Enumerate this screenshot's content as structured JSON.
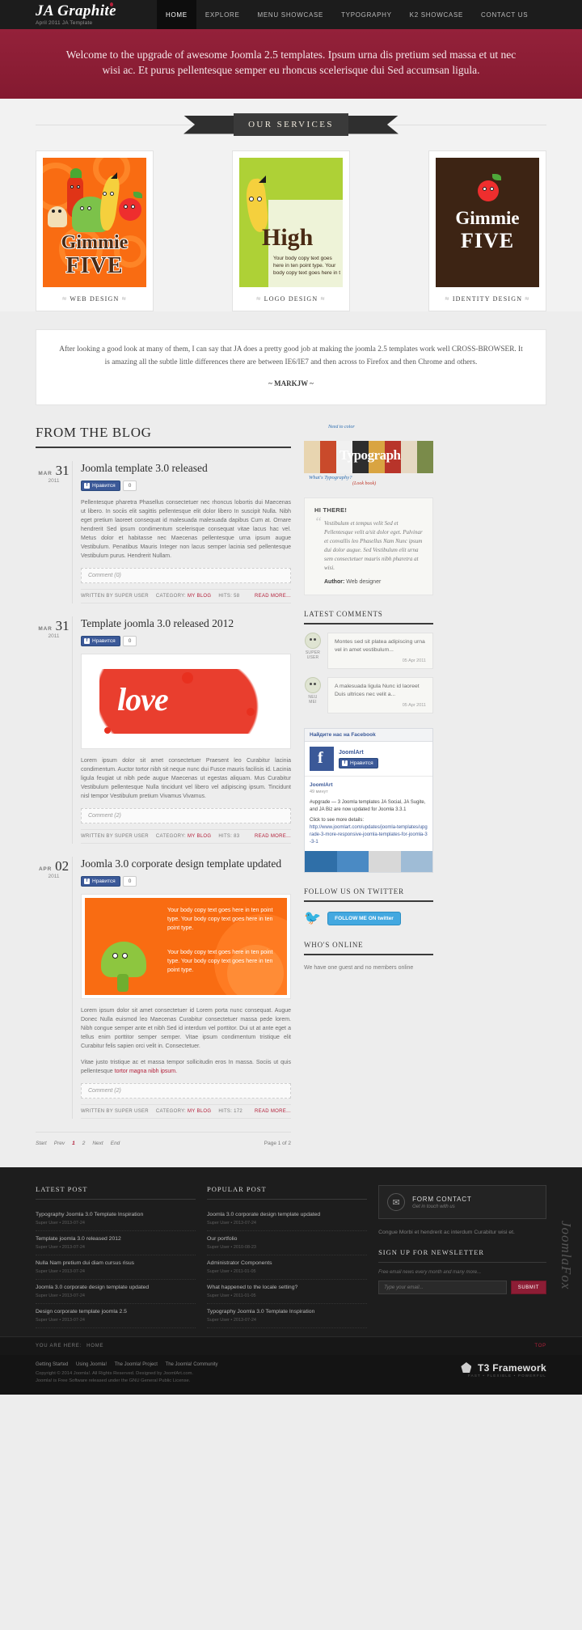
{
  "header": {
    "logo_title": "JA Graphite",
    "logo_sub": "April 2011 JA Template",
    "nav": [
      {
        "label": "HOME",
        "active": true
      },
      {
        "label": "EXPLORE",
        "active": false
      },
      {
        "label": "MENU SHOWCASE",
        "active": false
      },
      {
        "label": "TYPOGRAPHY",
        "active": false
      },
      {
        "label": "K2 SHOWCASE",
        "active": false
      },
      {
        "label": "CONTACT US",
        "active": false
      }
    ]
  },
  "hero": {
    "text": "Welcome to the upgrade of awesome Joomla 2.5 templates. Ipsum urna dis pretium sed massa et ut nec wisi ac. Et purus pellentesque semper eu rhoncus scelerisque dui Sed accumsan ligula."
  },
  "services": {
    "ribbon_label": "OUR SERVICES",
    "cards": [
      {
        "caption": "WEB DESIGN",
        "poster_line1": "Gimmie",
        "poster_line2": "FIVE",
        "style": "orange"
      },
      {
        "caption": "LOGO DESIGN",
        "poster_line1": "High",
        "poster_line2": "",
        "style": "green",
        "body": "Your body copy text goes here in ten point type. Your body copy text goes here in t"
      },
      {
        "caption": "IDENTITY DESIGN",
        "poster_line1": "Gimmie",
        "poster_line2": "FIVE",
        "style": "brown"
      }
    ]
  },
  "testimonial": {
    "text": "After looking a good look at many of them, I can say that JA does a pretty good job at making the joomla 2.5 templates work well CROSS-BROWSER. It is amazing all the subtle little differences there are between IE6/IE7 and then across to Firefox and then Chrome and others.",
    "author": "~ MARKJW ~"
  },
  "blog": {
    "section_title": "FROM THE BLOG",
    "posts": [
      {
        "month": "MAR",
        "day": "31",
        "year": "2011",
        "title": "Joomla template 3.0 released",
        "like_label": "Нравится",
        "like_count": "0",
        "text": "Pellentesque pharetra Phasellus consectetuer nec rhoncus lobortis dui Maecenas ut libero. In sociis elit sagittis pellentesque elit dolor libero In suscipit Nulla. Nibh eget pretium laoreet consequat id malesuada malesuada dapibus Cum at. Ornare hendrerit Sed ipsum condimentum scelerisque consequat vitae lacus hac vel. Metus dolor et habitasse nec Maecenas pellentesque urna ipsum augue Vestibulum. Penatibus Mauris Integer non lacus semper lacinia sed pellentesque Vestibulum purus. Hendrerit Nullam.",
        "comment_placeholder": "Comment (0)",
        "meta_author": "WRITTEN BY SUPER USER",
        "meta_category_label": "CATEGORY:",
        "meta_category": "MY BLOG",
        "meta_hits": "HITS: 58",
        "readmore": "READ MORE...",
        "figure": "none"
      },
      {
        "month": "MAR",
        "day": "31",
        "year": "2011",
        "title": "Template joomla 3.0 released 2012",
        "like_label": "Нравится",
        "like_count": "0",
        "text": "Lorem ipsum dolor sit amet consectetuer Praesent leo Curabitur lacinia condimentum. Auctor tortor nibh sit neque nunc dui Fusce mauris facilisis id. Lacinia ligula feugiat ut nibh pede augue Maecenas ut egestas aliquam. Mus Curabitur Vestibulum pellentesque Nulla tincidunt vel libero vel adipiscing ipsum. Tincidunt nisl tempor Vestibulum pretium Vivamus Vivamus.",
        "comment_placeholder": "Comment (2)",
        "meta_author": "WRITTEN BY SUPER USER",
        "meta_category_label": "CATEGORY:",
        "meta_category": "MY BLOG",
        "meta_hits": "HITS: 83",
        "readmore": "READ MORE...",
        "figure": "love"
      },
      {
        "month": "APR",
        "day": "02",
        "year": "2011",
        "title": "Joomla 3.0 corporate design template updated",
        "like_label": "Нравится",
        "like_count": "0",
        "text": "Lorem ipsum dolor sit amet consectetuer id Lorem porta nunc consequat. Augue Donec Nulla euismod leo Maecenas Curabitur consectetuer massa pede lorem. Nibh congue semper ante et nibh Sed id interdum vel porttitor. Dui ut at ante eget a tellus enim porttitor semper semper. Vitae ipsum condimentum tristique elit Curabitur felis sapien orci velit in. Consectetuer.",
        "text2": "Vitae justo tristique ac et massa tempor sollicitudin eros In massa. Sociis ut quis pellentesque",
        "text2_link": "tortor magna nibh ipsum.",
        "comment_placeholder": "Comment (2)",
        "meta_author": "WRITTEN BY SUPER USER",
        "meta_category_label": "CATEGORY:",
        "meta_category": "MY BLOG",
        "meta_hits": "HITS: 172",
        "readmore": "READ MORE...",
        "figure": "broccoli",
        "figure_text1": "Your body copy text goes here in ten point type. Your body copy text goes here in ten point type.",
        "figure_text2": "Your body copy text goes here in ten point type. Your body copy text goes here in ten point type."
      }
    ],
    "pagination": {
      "start": "Start",
      "prev": "Prev",
      "pages": [
        "1",
        "2"
      ],
      "current": "1",
      "next": "Next",
      "end": "End",
      "status": "Page 1 of 2"
    }
  },
  "sidebar": {
    "typo_banner": {
      "note_top": "Need to color",
      "note_bottom": "What's Typography?",
      "note_bottom2": "(Look book)",
      "word": "Typograph"
    },
    "quote": {
      "hi": "HI THERE!",
      "text": "Vestibulum et tempus velit Sed et Pellentesque velit a/sit dolor eget. Pulvinar et convallis leo Phasellus Nam Nunc ipsum dui dolor augue. Sed Vestibulum elit urna sem consectetuer mauris nibh pharetra at wisi.",
      "author_label": "Author:",
      "author": "Web designer"
    },
    "comments": {
      "title": "LATEST COMMENTS",
      "items": [
        {
          "name": "SUPER USER",
          "text": "Montes sed sit platea adipiscing urna vel in amet vestibulum...",
          "date": "05 Apr 2011"
        },
        {
          "name": "NEU MEI",
          "text": "A malesuada ligula Nunc id laoreet Duis ultrices nec velit a...",
          "date": "05 Apr 2011"
        }
      ]
    },
    "facebook": {
      "header": "Найдите нас на Facebook",
      "page_name": "JoomlArt",
      "like_label": "Нравится",
      "post_author": "JoomlArt",
      "post_time": "49 минут",
      "post_text": "#upgrade — 3 Joomla templates JA Social, JA Sugite, and JA Biz are now updated for Joomla 3.3.1",
      "post_cta": "Click to see more details:",
      "post_link": "http://www.joomlart.com/updates/joomla-templates/upgrade-3-more-responsive-joomla-templates-for-joomla-3-3-1"
    },
    "twitter": {
      "title": "FOLLOW US ON TWITTER",
      "button": "FOLLOW ME ON twitter"
    },
    "who_online": {
      "title": "WHO'S ONLINE",
      "text": "We have one guest and no members online"
    }
  },
  "footer": {
    "latest_post": {
      "title": "LATEST POST",
      "items": [
        {
          "t": "Typography Joomla 3.0 Template Inspiration",
          "m": "Super User • 2013-07-24"
        },
        {
          "t": "Template joomla 3.0 released 2012",
          "m": "Super User • 2013-07-24"
        },
        {
          "t": "Nulla Nam pretium dui diam cursus risus",
          "m": "Super User • 2013-07-24"
        },
        {
          "t": "Joomla 3.0 corporate design template updated",
          "m": "Super User • 2013-07-24"
        },
        {
          "t": "Design corporate template joomla 2.5",
          "m": "Super User • 2013-07-24"
        }
      ]
    },
    "popular_post": {
      "title": "POPULAR POST",
      "items": [
        {
          "t": "Joomla 3.0 corporate design template updated",
          "m": "Super User • 2013-07-24"
        },
        {
          "t": "Our portfolio",
          "m": "Super User • 2010-08-23"
        },
        {
          "t": "Administrator Components",
          "m": "Super User • 2011-01-05"
        },
        {
          "t": "What happened to the locale setting?",
          "m": "Super User • 2011-01-05"
        },
        {
          "t": "Typography Joomla 3.0 Template Inspiration",
          "m": "Super User • 2013-07-24"
        }
      ]
    },
    "contact": {
      "icon_title": "FORM CONTACT",
      "icon_sub": "Get in touch with us",
      "text_part1": "Congue Morbi et hendrerit ac interdum Curabitur wisi et.",
      "newsletter_title": "SIGN UP FOR NEWSLETTER",
      "newsletter_note": "Free email news every month and many more...",
      "newsletter_placeholder": "Type your email...",
      "newsletter_button": "SUBMIT"
    },
    "joomlafox": "JoomlaFox",
    "breadcrumb_label": "YOU ARE HERE:",
    "breadcrumb_item": "HOME",
    "top_label": "TOP",
    "bottom_links": [
      "Getting Started",
      "Using Joomla!",
      "The Joomla! Project",
      "The Joomla! Community"
    ],
    "copyright1": "Copyright © 2014 Joomla!. All Rights Reserved. Designed by JoomlArt.com.",
    "copyright2": "Joomla! is Free Software released under the GNU General Public License.",
    "t3_name": "T3 Framework",
    "t3_tag": "Fast • Flexible • Powerful"
  }
}
